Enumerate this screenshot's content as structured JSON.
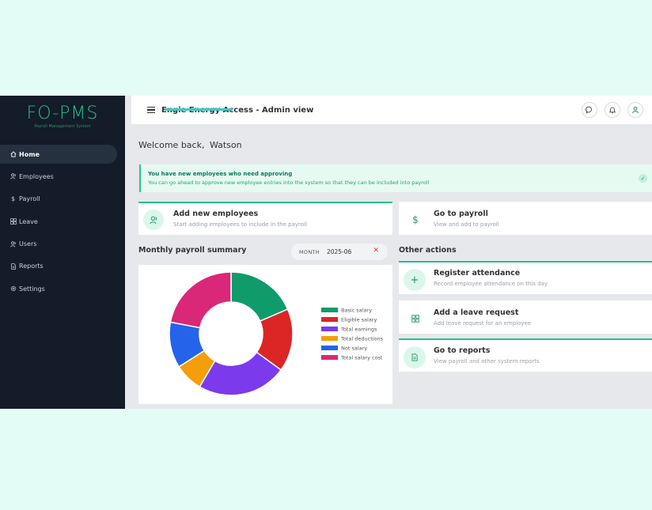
{
  "brand": {
    "title": "FO-PMS",
    "subtitle": "Payroll Management System"
  },
  "nav": [
    {
      "label": "Home",
      "icon": "home-icon",
      "active": true
    },
    {
      "label": "Employees",
      "icon": "employees-icon"
    },
    {
      "label": "Payroll",
      "icon": "dollar-icon"
    },
    {
      "label": "Leave",
      "icon": "grid-icon"
    },
    {
      "label": "Users",
      "icon": "users-icon"
    },
    {
      "label": "Reports",
      "icon": "document-icon"
    },
    {
      "label": "Settings",
      "icon": "gear-icon"
    }
  ],
  "header": {
    "org_prefix": "Engie Energy Access",
    "org_suffix": " - Admin view",
    "icons": [
      "chat-icon",
      "bell-icon",
      "user-icon"
    ]
  },
  "welcome": {
    "prefix": "Welcome back,",
    "name": "Watson"
  },
  "alert": {
    "title": "You have new employees who need approving",
    "message": "You can go ahead to approve new employee entries into the system so that they can be included into payroll"
  },
  "actions": {
    "add_employees": {
      "title": "Add new employees",
      "subtitle": "Start adding employees to include in the payroll"
    },
    "go_payroll": {
      "title": "Go to payroll",
      "subtitle": "View and add to payroll"
    }
  },
  "summary": {
    "title": "Monthly payroll summary",
    "month_label": "MONTH",
    "month_value": "2025-06",
    "clear_symbol": "✕"
  },
  "other_actions": {
    "title": "Other actions",
    "items": [
      {
        "title": "Register attendance",
        "subtitle": "Record employee attendance on this day",
        "icon": "plus-icon"
      },
      {
        "title": "Add a leave request",
        "subtitle": "Add leave request for an employee",
        "icon": "grid-icon"
      },
      {
        "title": "Go to reports",
        "subtitle": "View payroll and other system reports",
        "icon": "document-icon"
      }
    ]
  },
  "chart_data": {
    "type": "pie",
    "subtype": "doughnut",
    "legend_position": "right",
    "series": [
      {
        "name": "Basic salary",
        "value": 18.5,
        "color": "#109b6a"
      },
      {
        "name": "Eligible salary",
        "value": 16.5,
        "color": "#dc2626"
      },
      {
        "name": "Total earnings",
        "value": 23.5,
        "color": "#7c3aed"
      },
      {
        "name": "Total deductions",
        "value": 7.5,
        "color": "#f59e0b"
      },
      {
        "name": "Not salary",
        "value": 12,
        "color": "#2563eb"
      },
      {
        "name": "Total salary cost",
        "value": 22,
        "color": "#db2777"
      }
    ]
  }
}
